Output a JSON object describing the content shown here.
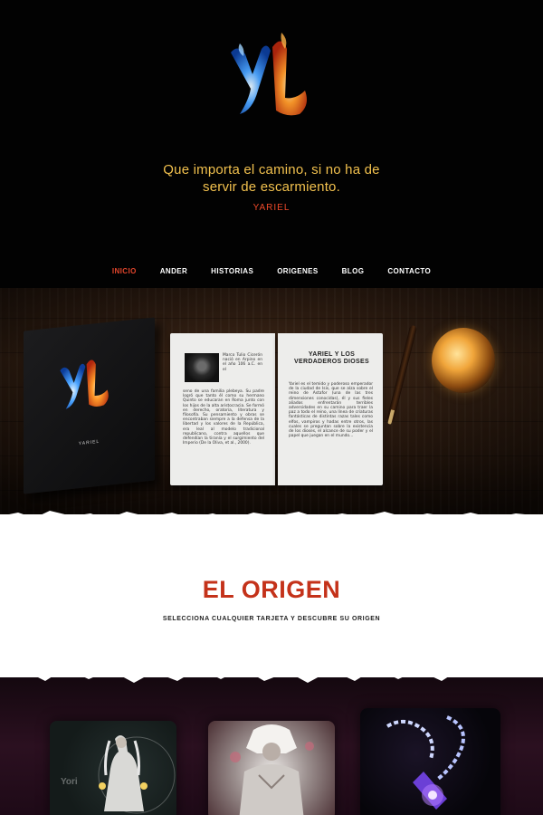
{
  "brand": {
    "logo_text": "YL",
    "colors": {
      "blue_flame": "#2f7de0",
      "orange_flame": "#f06a1c",
      "accent_red": "#c4321a",
      "quote_gold": "#f2c14e"
    }
  },
  "hero": {
    "quote": "Que importa el camino, si no ha de servir de escarmiento.",
    "author": "YARIEL"
  },
  "nav": {
    "items": [
      {
        "label": "INICIO",
        "active": true
      },
      {
        "label": "ANDER",
        "active": false
      },
      {
        "label": "HISTORIAS",
        "active": false
      },
      {
        "label": "ORIGENES",
        "active": false
      },
      {
        "label": "BLOG",
        "active": false
      },
      {
        "label": "CONTACTO",
        "active": false
      }
    ]
  },
  "book": {
    "cover_name": "YARIEL",
    "left_page_text_a": "Marco Tulio Cicerón nació en Arpino en el año 106 a.C. en el",
    "left_page_text_b": "seno de una familia plebeya. Su padre logró que tanto él como su hermano Quinto se educaran en Roma junto con los hijos de la alta aristocracia. Se formó en derecho, oratoria, literatura y filosofía. Su pensamiento y obras se encontraban siempre a la defensa de la libertad y los valores de la República, era leal al modelo tradicional republicano, contra aquellos que defendían la tiranía y el surgimiento del Imperio (De la Oliva, et al., 2000).",
    "right_page_title": "YARIEL Y LOS VERDADEROS DIOSES",
    "right_page_text": "Yariel es el temido y poderoso emperador de la ciudad de Isis, que se alza sobre el reino de Astafor (una de las tres dimensiones conocidas), él y sus fieles aliados enfrentarán terribles adversidades en su camino para traer la paz a todo el reino, una línea de criaturas fantásticas de distintas razas tales como elfos, vampiros y hadas entre otros, las cuales se preguntan sobre la existencia de los dioses, el alcance de su poder y el papel que juegan en el mundo..."
  },
  "origin": {
    "title": "EL ORIGEN",
    "subtitle": "SELECCIONA CUALQUIER TARJETA Y DESCUBRE SU ORIGEN"
  },
  "cards": [
    {
      "name": "character-white-robe",
      "overlay_text": "Yori"
    },
    {
      "name": "character-armored-white-hair",
      "overlay_text": ""
    },
    {
      "name": "artifact-chain-weapon",
      "overlay_text": ""
    }
  ]
}
